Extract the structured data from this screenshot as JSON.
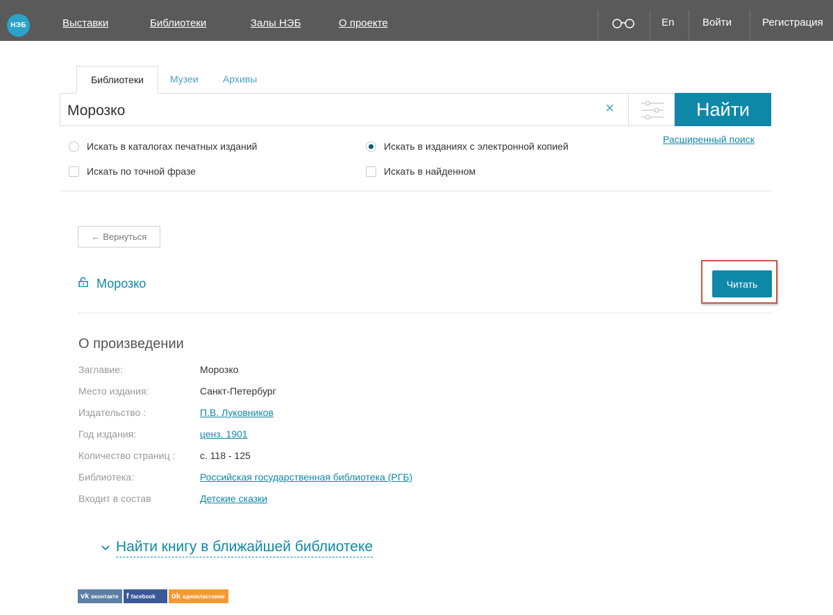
{
  "header": {
    "logo": "НЭБ",
    "nav": [
      "Выставки",
      "Библиотеки",
      "Залы НЭБ",
      "О проекте"
    ],
    "lang": "En",
    "login": "Войти",
    "register": "Регистрация"
  },
  "search": {
    "tabs": [
      "Библиотеки",
      "Музеи",
      "Архивы"
    ],
    "query": "Морозко",
    "submit_label": "Найти",
    "advanced_label": "Расширенный поиск",
    "options": {
      "printed_catalogs": "Искать в каталогах печатных изданий",
      "electronic_copy": "Искать в изданиях с электронной копией",
      "exact_phrase": "Искать по точной фразе",
      "in_found": "Искать в найденном"
    }
  },
  "record": {
    "back_label": "← Вернуться",
    "title": "Морозко",
    "read_label": "Читать",
    "section_title": "О произведении",
    "fields": [
      {
        "label": "Заглавие:",
        "value": "Морозко",
        "link": false
      },
      {
        "label": "Место издания:",
        "value": "Санкт-Петербург",
        "link": false
      },
      {
        "label": "Издательство :",
        "value": "П.В. Луковников",
        "link": true
      },
      {
        "label": "Год издания:",
        "value": "ценз. 1901",
        "link": true
      },
      {
        "label": "Количество страниц :",
        "value": "с. 118 - 125",
        "link": false
      },
      {
        "label": "Библиотека:",
        "value": "Российская государственная библиотека (РГБ)",
        "link": true
      },
      {
        "label": "Входит в состав",
        "value": "Детские сказки",
        "link": true
      }
    ],
    "find_library_label": "Найти книгу в ближайшей библиотеке"
  },
  "share": {
    "vk": "вконтакте",
    "fb": "facebook",
    "ok": "одноклассники"
  },
  "colors": {
    "topbar": "#5b5a5a",
    "accent": "#0f88a8",
    "highlight": "#c0584a"
  }
}
